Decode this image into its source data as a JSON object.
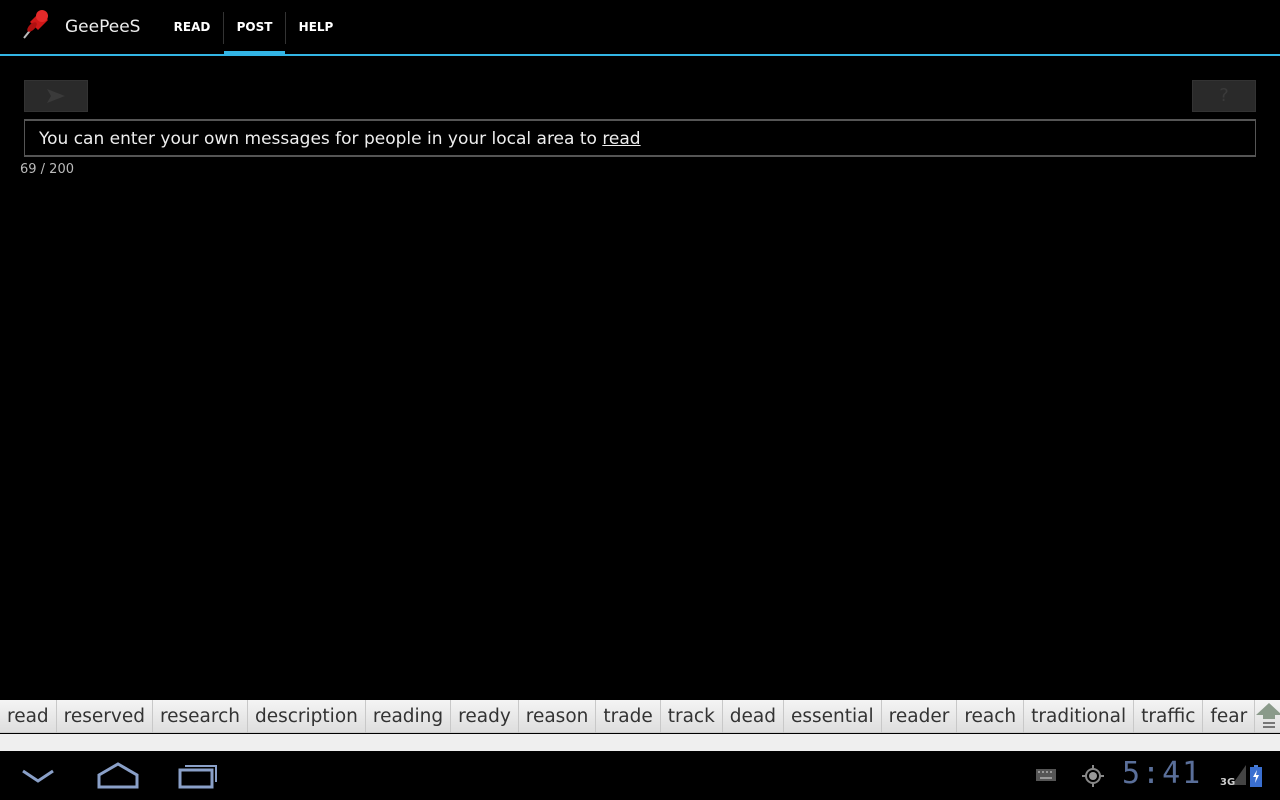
{
  "app": {
    "name": "GeePeeS",
    "icon": "pushpin-icon"
  },
  "tabs": [
    {
      "label": "READ"
    },
    {
      "label": "POST",
      "selected": true
    },
    {
      "label": "HELP"
    }
  ],
  "toolbar": {
    "send_icon": "send-arrow-icon",
    "help_icon": "question-icon",
    "help_label": "?"
  },
  "message": {
    "text": "You can enter your own messages for people in your local area to ",
    "underlined_word": "read",
    "counter": "69 / 200"
  },
  "suggestions": [
    "read",
    "reserved",
    "research",
    "description",
    "reading",
    "ready",
    "reason",
    "trade",
    "track",
    "dead",
    "essential",
    "reader",
    "reach",
    "traditional",
    "traffic",
    "fear"
  ],
  "status": {
    "time": "5:41",
    "network": "3G"
  },
  "colors": {
    "accent": "#33b5e5"
  }
}
